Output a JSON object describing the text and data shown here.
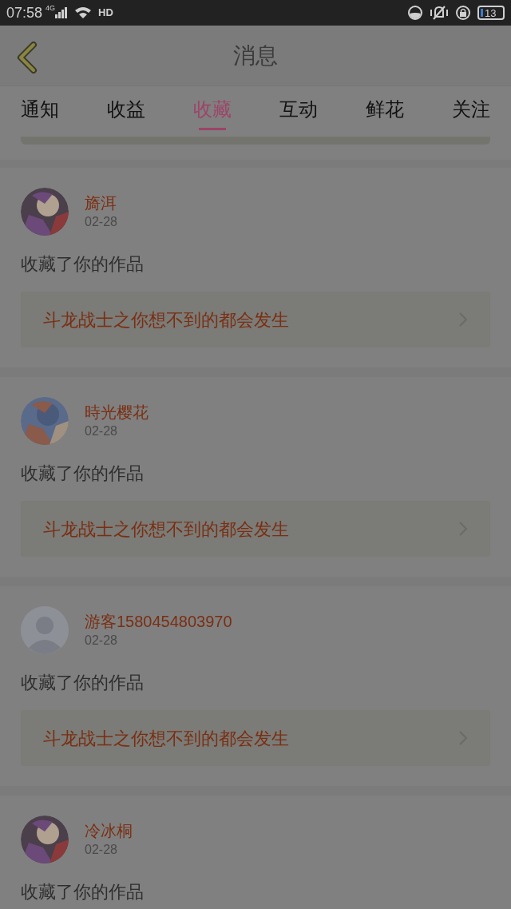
{
  "status_bar": {
    "time": "07:58",
    "network": "4G",
    "hd": "HD",
    "battery": "13"
  },
  "header": {
    "title": "消息"
  },
  "tabs": [
    {
      "label": "通知",
      "selected": false
    },
    {
      "label": "收益",
      "selected": false
    },
    {
      "label": "收藏",
      "selected": true
    },
    {
      "label": "互动",
      "selected": false
    },
    {
      "label": "鲜花",
      "selected": false
    },
    {
      "label": "关注",
      "selected": false
    }
  ],
  "messages": [
    {
      "name": "旖洱",
      "date": "02-28",
      "action": "收藏了你的作品",
      "work": "斗龙战士之你想不到的都会发生"
    },
    {
      "name": "時光樱花",
      "date": "02-28",
      "action": "收藏了你的作品",
      "work": "斗龙战士之你想不到的都会发生"
    },
    {
      "avatar": {
        "kind": "default"
      },
      "name": "游客1580454803970",
      "date": "02-28",
      "action": "收藏了你的作品",
      "work": "斗龙战士之你想不到的都会发生"
    },
    {
      "name": "冷冰桐",
      "date": "02-28",
      "action": "收藏了你的作品"
    }
  ]
}
